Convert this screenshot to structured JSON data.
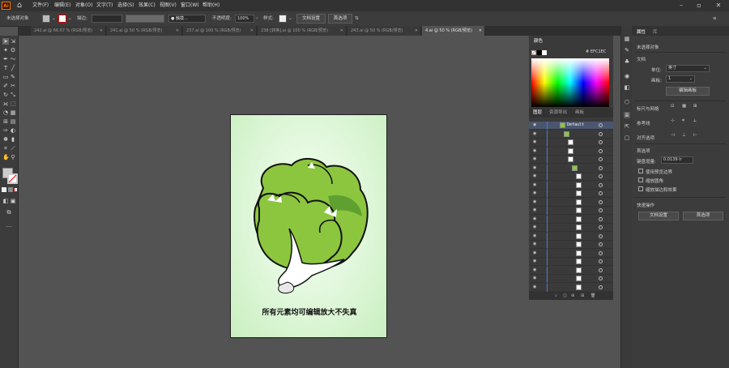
{
  "app": {
    "logo": "Ai",
    "home_icon": "home-icon"
  },
  "menu": [
    "文件(F)",
    "编辑(E)",
    "对象(O)",
    "文字(T)",
    "选择(S)",
    "效果(C)",
    "视图(V)",
    "窗口(W)",
    "帮助(H)"
  ],
  "control_bar": {
    "no_selection": "未选择对象",
    "stroke_label": "描边:",
    "brush_label": "● 触摸...",
    "opacity_label": "不透明度:",
    "opacity_value": "100%",
    "style_label": "样式:",
    "doc_setup": "文档设置",
    "preferences": "首选项"
  },
  "tabs": [
    {
      "label": "242.ai @ 66.67 % (RGB/预览)",
      "active": false
    },
    {
      "label": "241.ai @ 50 % (RGB/预览)",
      "active": false
    },
    {
      "label": "237.ai @ 100 % (RGB/预览)",
      "active": false
    },
    {
      "label": "238 [转换].ai @ 100 % (RGB/预览)",
      "active": false
    },
    {
      "label": "243.ai @ 50 % (RGB/预览)",
      "active": false
    },
    {
      "label": "4.ai @ 50 % (RGB/预览)",
      "active": true
    }
  ],
  "artboard": {
    "caption": "所有元素均可编辑放大不失真",
    "colors": {
      "leaf_light": "#8cc63f",
      "leaf_dark": "#5fa131",
      "stem": "#ffffff",
      "outline": "#111111"
    }
  },
  "color_panel": {
    "title": "颜色",
    "hex": "EFC1EC"
  },
  "layers_panel": {
    "tabs": [
      "图层",
      "资源导出",
      "画板"
    ],
    "top_layer": "Default",
    "row_count": 20
  },
  "properties": {
    "tabs": [
      "属性",
      "库"
    ],
    "no_selection": "未选择对象",
    "document_section": "文档",
    "units_label": "单位:",
    "units_value": "英寸",
    "artboard_label": "画板:",
    "artboard_value": "1",
    "edit_artboard": "编辑画板",
    "rulers_grids": "标尺与网格",
    "guides": "参考线",
    "snap_options": "对齐选项",
    "preferences_section": "首选项",
    "keyboard_increment_label": "键盘增量:",
    "keyboard_increment_value": "0.0139 ir",
    "use_preview_bounds": "使用预览边界",
    "scale_corners": "缩放圆角",
    "scale_strokes": "缩放描边和效果",
    "quick_actions": "快速操作",
    "doc_setup_btn": "文档设置",
    "prefs_btn": "首选项"
  }
}
